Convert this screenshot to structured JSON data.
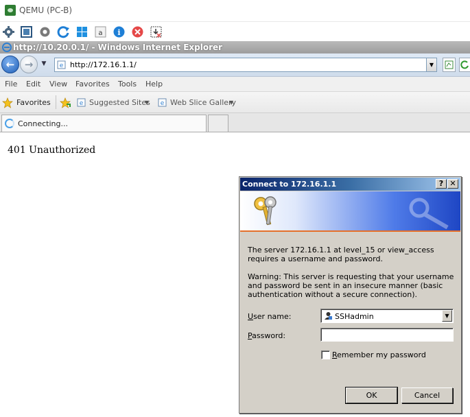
{
  "qemu": {
    "title": "QEMU (PC-B)",
    "toolbar_icons": [
      "settings-cog-icon",
      "fullscreen-icon",
      "gear-icon",
      "refresh-icon",
      "windows-logo-icon",
      "keyboard-a-icon",
      "info-icon",
      "stop-icon",
      "screenshot-icon"
    ]
  },
  "browser": {
    "window_title": "http://10.20.0.1/ - Windows Internet Explorer",
    "address": "http://172.16.1.1/",
    "menu": [
      "File",
      "Edit",
      "View",
      "Favorites",
      "Tools",
      "Help"
    ],
    "favorites_label": "Favorites",
    "favorites_items": [
      "Suggested Sites",
      "Web Slice Gallery"
    ],
    "tab_label": "Connecting..."
  },
  "page": {
    "heading": "401 Unauthorized"
  },
  "dialog": {
    "title": "Connect to 172.16.1.1",
    "help_button": "?",
    "close_button": "✕",
    "message": "The server 172.16.1.1 at level_15 or view_access requires a username and password.",
    "warning": "Warning: This server is requesting that your username and password be sent in an insecure manner (basic authentication without a secure connection).",
    "username_label_pre": "U",
    "username_label_post": "ser name:",
    "password_label_pre": "P",
    "password_label_post": "assword:",
    "username_value": "SSHadmin",
    "password_value": "",
    "remember_label_pre": "R",
    "remember_label_post": "emember my password",
    "remember_checked": false,
    "ok_label": "OK",
    "cancel_label": "Cancel"
  },
  "colors": {
    "dialog_bg": "#d4d0c8",
    "title_blue": "#0a246a",
    "banner_accent": "#e5702a"
  }
}
